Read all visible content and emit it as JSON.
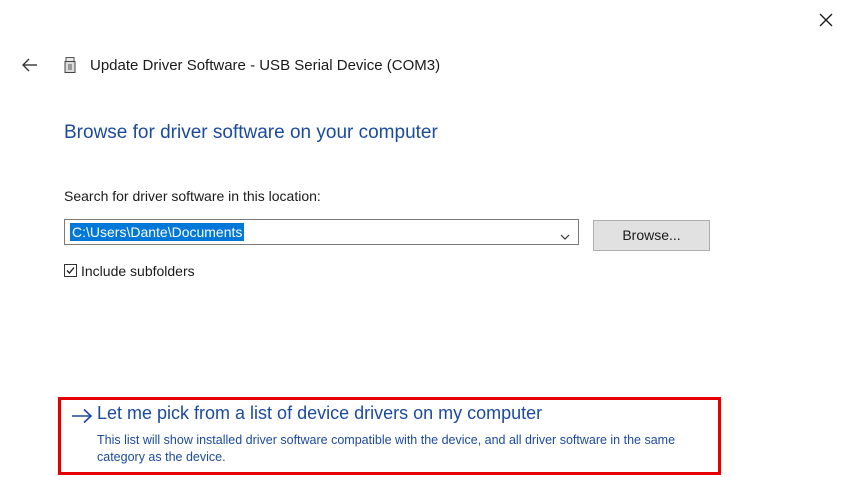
{
  "window": {
    "close_glyph": "✕",
    "close_icon": "close-icon"
  },
  "header": {
    "back_icon": "back-arrow-icon",
    "device_icon": "usb-device-icon",
    "title": "Update Driver Software - USB Serial Device (COM3)"
  },
  "main": {
    "heading": "Browse for driver software on your computer",
    "location_label": "Search for driver software in this location:",
    "path_value": "C:\\Users\\Dante\\Documents",
    "browse_label": "Browse...",
    "include_subfolders_label": "Include subfolders",
    "include_subfolders_checked": true
  },
  "pick_option": {
    "arrow_icon": "right-arrow-icon",
    "title": "Let me pick from a list of device drivers on my computer",
    "description": "This list will show installed driver software compatible with the device, and all driver software in the same category as the device."
  },
  "colors": {
    "link_blue": "#1b4a9f",
    "selection_blue": "#0078d7",
    "highlight_red": "#e60000"
  }
}
